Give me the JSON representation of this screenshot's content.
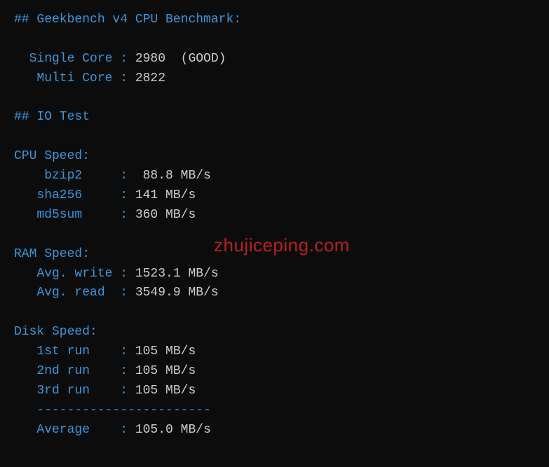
{
  "section1": {
    "header": "## Geekbench v4 CPU Benchmark:",
    "single_core_label": "  Single Core :",
    "single_core_value": " 2980  (GOOD)",
    "multi_core_label": "   Multi Core :",
    "multi_core_value": " 2822"
  },
  "section2": {
    "header": "## IO Test"
  },
  "cpu_speed": {
    "header": "CPU Speed:",
    "bzip2_label": "    bzip2     :",
    "bzip2_value": "  88.8 MB/s",
    "sha256_label": "   sha256     :",
    "sha256_value": " 141 MB/s",
    "md5sum_label": "   md5sum     :",
    "md5sum_value": " 360 MB/s"
  },
  "ram_speed": {
    "header": "RAM Speed:",
    "write_label": "   Avg. write :",
    "write_value": " 1523.1 MB/s",
    "read_label": "   Avg. read  :",
    "read_value": " 3549.9 MB/s"
  },
  "disk_speed": {
    "header": "Disk Speed:",
    "run1_label": "   1st run    :",
    "run1_value": " 105 MB/s",
    "run2_label": "   2nd run    :",
    "run2_value": " 105 MB/s",
    "run3_label": "   3rd run    :",
    "run3_value": " 105 MB/s",
    "divider": "   -----------------------",
    "avg_label": "   Average    :",
    "avg_value": " 105.0 MB/s"
  },
  "watermark": "zhujiceping.com"
}
